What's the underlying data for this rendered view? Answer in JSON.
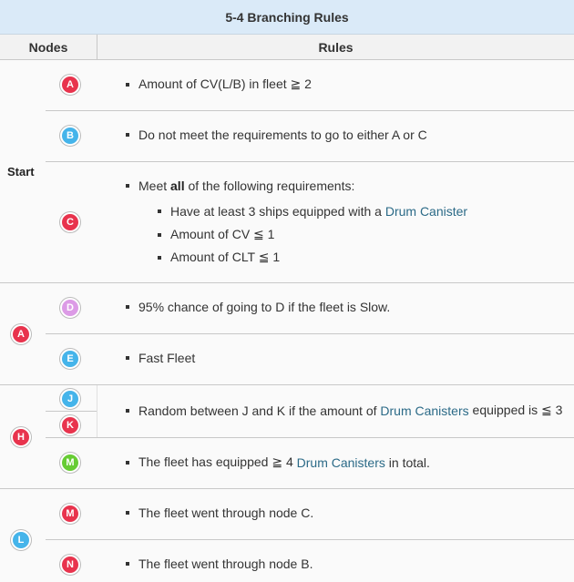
{
  "title": "5-4 Branching Rules",
  "headers": {
    "nodes": "Nodes",
    "rules": "Rules"
  },
  "colors": {
    "red": "#e8334d",
    "blue": "#45b4ea",
    "pink": "#dc9be6",
    "green": "#66cc33",
    "link": "#2b6a87",
    "title_bg": "#daeaf8"
  },
  "start_label": "Start",
  "nodes": {
    "A": "A",
    "B": "B",
    "C": "C",
    "D": "D",
    "E": "E",
    "H": "H",
    "J": "J",
    "K": "K",
    "M": "M",
    "L": "L",
    "N": "N"
  },
  "rules": {
    "a_cv": "Amount of CV(L/B) in fleet ≧ 2",
    "b_fallback": "Do not meet the requirements to go to either A or C",
    "c_intro_pre": "Meet ",
    "c_intro_bold": "all",
    "c_intro_post": " of the following requirements:",
    "c_req1_pre": "Have at least 3 ships equipped with a ",
    "c_req1_link": "Drum Canister",
    "c_req2": "Amount of CV ≦ 1",
    "c_req3": "Amount of CLT ≦ 1",
    "d_slow": "95% chance of going to D if the fleet is Slow.",
    "e_fast": "Fast Fleet",
    "jk_pre": "Random between J and K if the amount of ",
    "jk_link": "Drum Canisters",
    "jk_post": " equipped is ≦ 3",
    "m_pre": "The fleet has equipped ≧ 4 ",
    "m_link": "Drum Canisters",
    "m_post": " in total.",
    "lm": "The fleet went through node C.",
    "ln": "The fleet went through node B."
  }
}
